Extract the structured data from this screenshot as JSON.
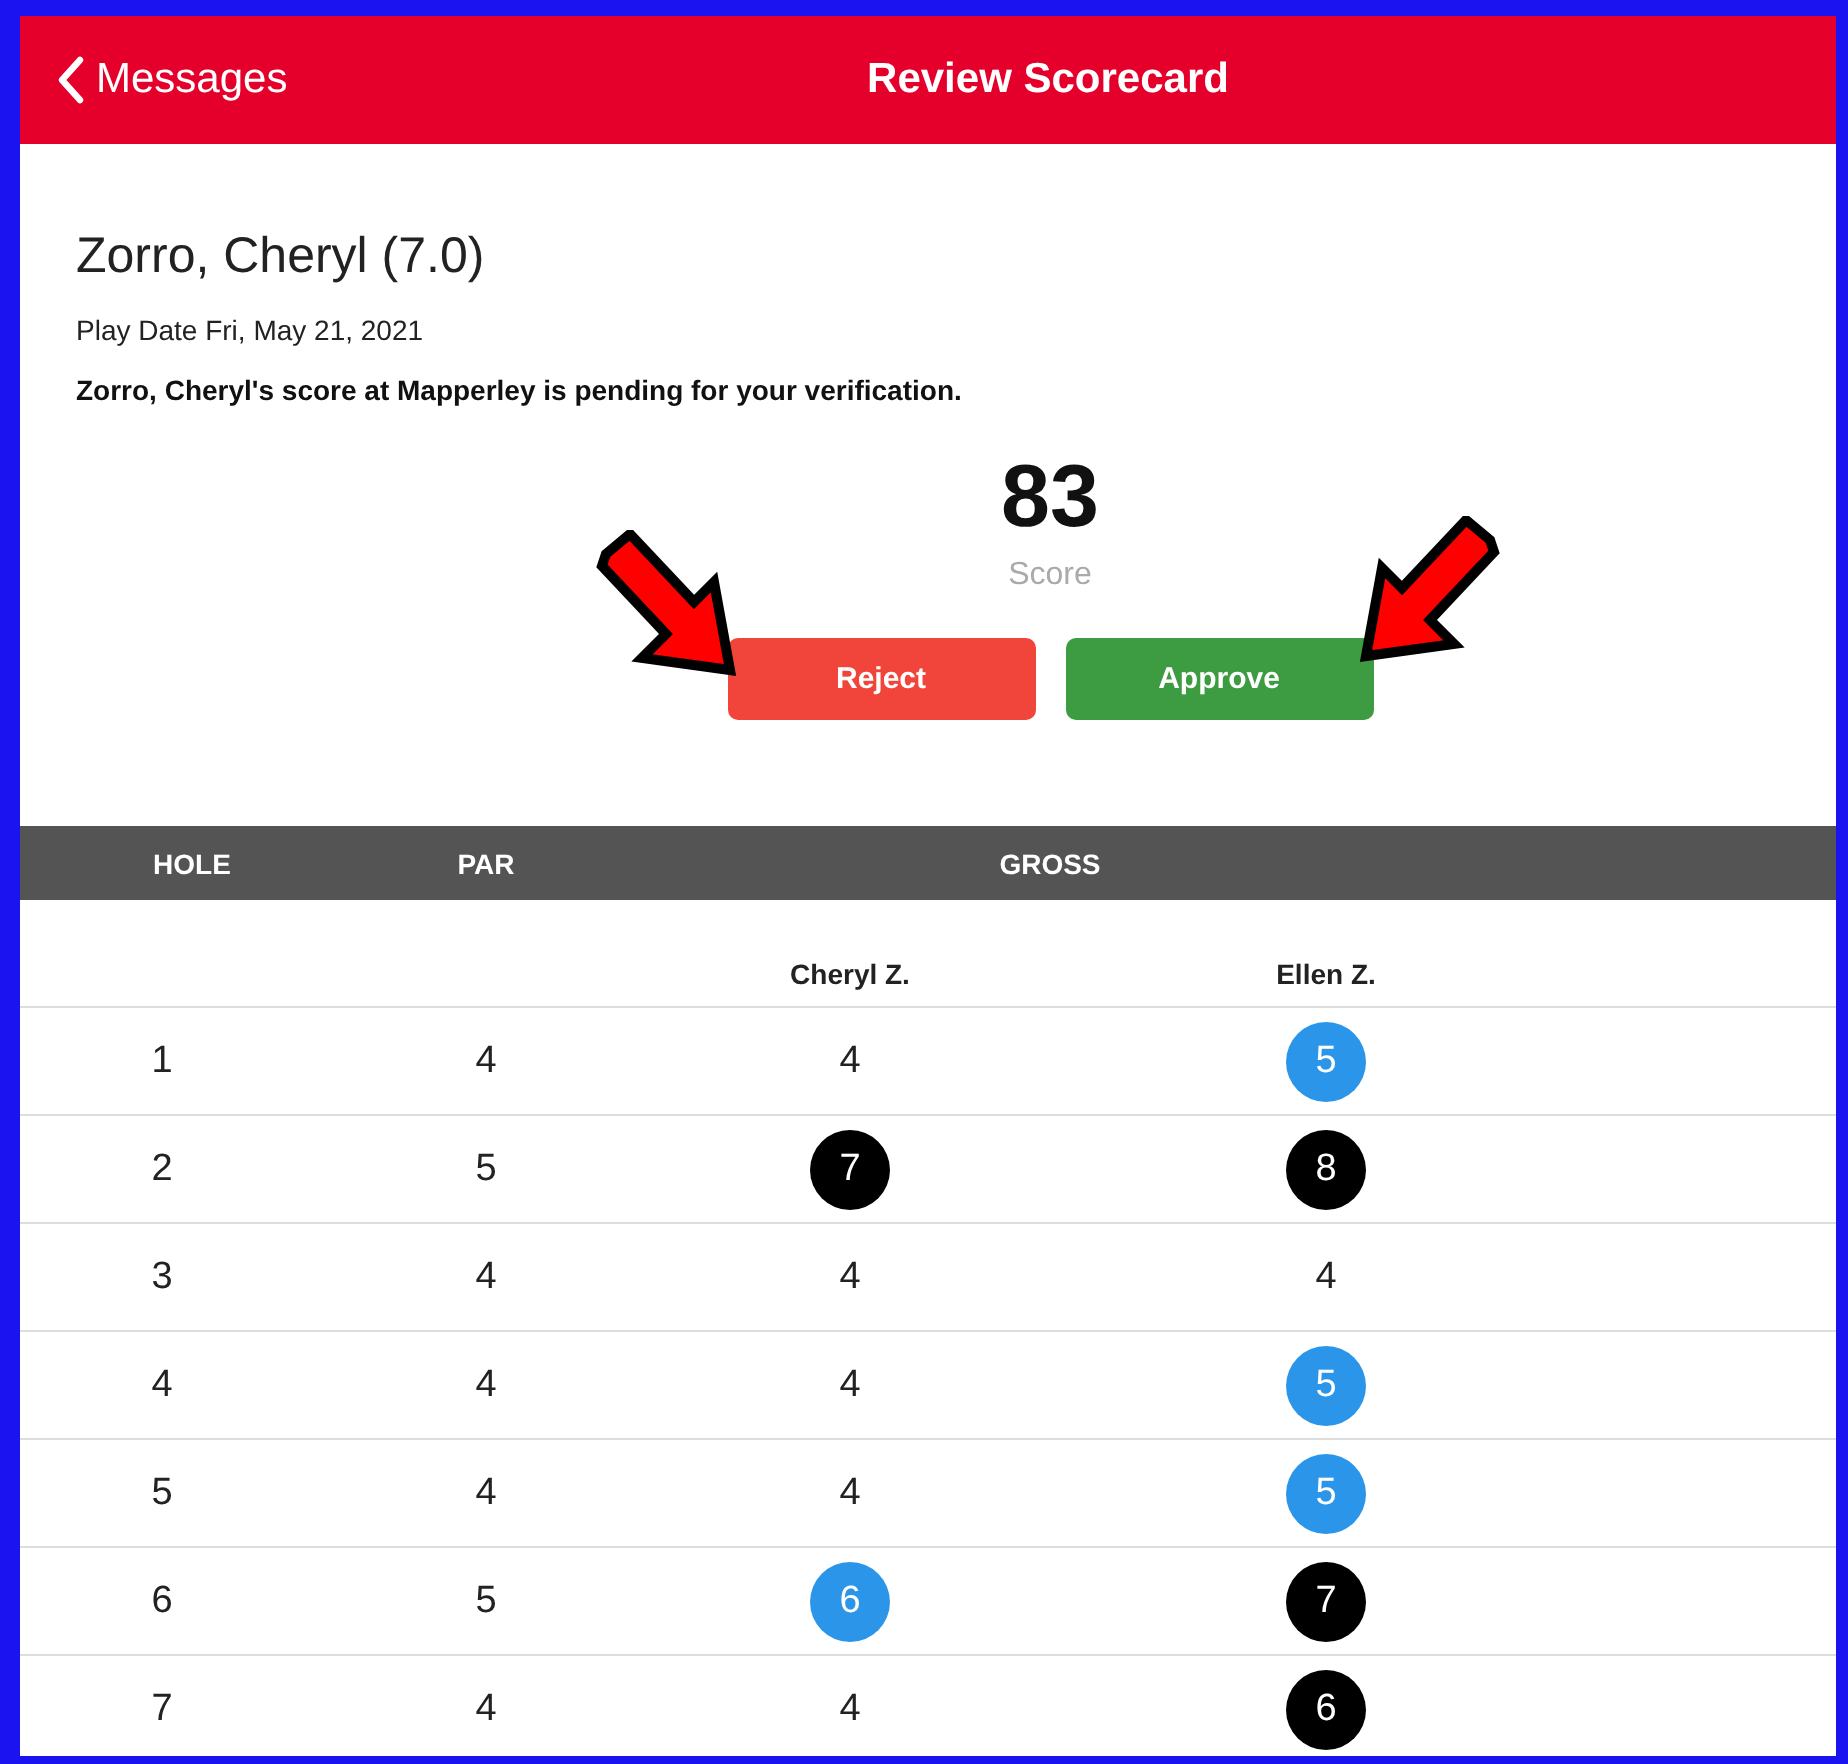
{
  "nav": {
    "back": "Messages",
    "title": "Review Scorecard"
  },
  "player": {
    "name": "Zorro, Cheryl (7.0)",
    "play_date": "Play Date Fri, May 21, 2021",
    "notice": "Zorro, Cheryl's score at Mapperley is pending for your verification."
  },
  "score": {
    "value": "83",
    "label": "Score"
  },
  "buttons": [
    {
      "label": "Reject",
      "kind": "reject"
    },
    {
      "label": "Approve",
      "kind": "approve"
    }
  ],
  "table": {
    "columns": [
      "HOLE",
      "PAR",
      "GROSS"
    ],
    "players": [
      "Cheryl Z.",
      "Ellen Z."
    ],
    "rows": [
      {
        "hole": "1",
        "par": "4",
        "scores": [
          {
            "value": "4",
            "kind": "par"
          },
          {
            "value": "5",
            "kind": "bogey"
          }
        ]
      },
      {
        "hole": "2",
        "par": "5",
        "scores": [
          {
            "value": "7",
            "kind": "double"
          },
          {
            "value": "8",
            "kind": "double"
          }
        ]
      },
      {
        "hole": "3",
        "par": "4",
        "scores": [
          {
            "value": "4",
            "kind": "par"
          },
          {
            "value": "4",
            "kind": "par"
          }
        ]
      },
      {
        "hole": "4",
        "par": "4",
        "scores": [
          {
            "value": "4",
            "kind": "par"
          },
          {
            "value": "5",
            "kind": "bogey"
          }
        ]
      },
      {
        "hole": "5",
        "par": "4",
        "scores": [
          {
            "value": "4",
            "kind": "par"
          },
          {
            "value": "5",
            "kind": "bogey"
          }
        ]
      },
      {
        "hole": "6",
        "par": "5",
        "scores": [
          {
            "value": "6",
            "kind": "bogey"
          },
          {
            "value": "7",
            "kind": "double"
          }
        ]
      },
      {
        "hole": "7",
        "par": "4",
        "scores": [
          {
            "value": "4",
            "kind": "par"
          },
          {
            "value": "6",
            "kind": "double"
          }
        ]
      }
    ]
  }
}
